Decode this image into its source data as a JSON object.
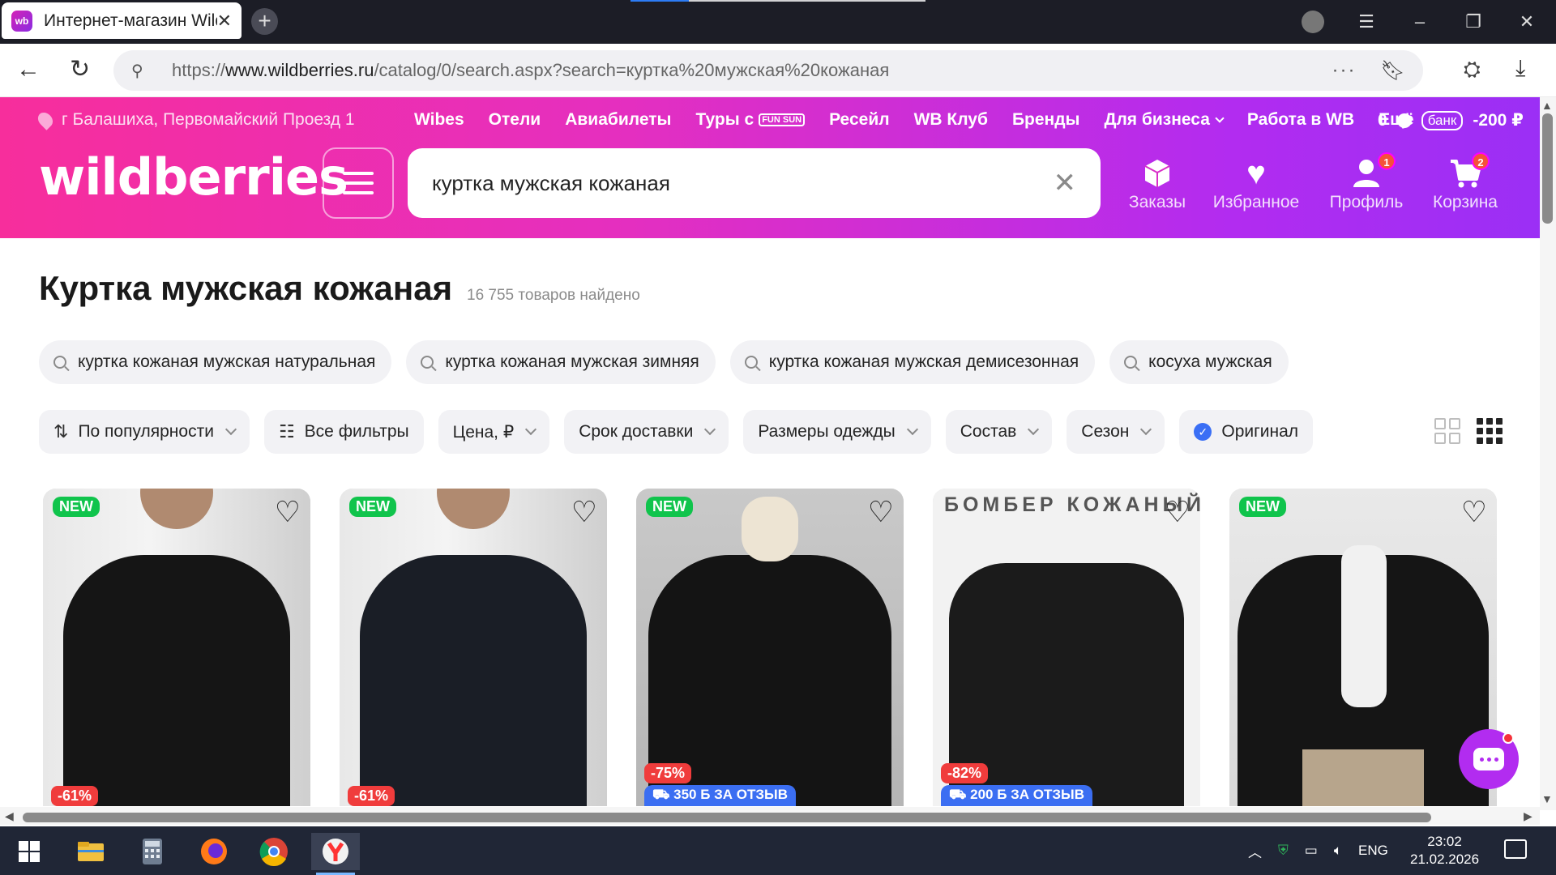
{
  "browser": {
    "tab_title": "Интернет-магазин Wildberries",
    "tab_favicon": "wb",
    "url_scheme": "https://",
    "url_host": "www.wildberries.ru",
    "url_path": "/catalog/0/search.aspx?search=куртка%20мужская%20кожаная"
  },
  "header": {
    "location": "г Балашиха, Первомайский Проезд 1",
    "links": [
      "Wibes",
      "Отели",
      "Авиабилеты",
      "Туры с",
      "Ресейл",
      "WB Клуб",
      "Бренды",
      "Для бизнеса",
      "Работа в WB",
      "Ещё"
    ],
    "funsun": "FUN SUN",
    "wallet_balance": "0",
    "bank_label": "банк",
    "bank_bonus": "-200 ₽",
    "logo": "wildberries",
    "search_query": "куртка мужская кожаная",
    "icons": [
      {
        "label": "Заказы",
        "badge": ""
      },
      {
        "label": "Избранное",
        "badge": ""
      },
      {
        "label": "Профиль",
        "badge": "1"
      },
      {
        "label": "Корзина",
        "badge": "2"
      }
    ],
    "colors": {
      "gradient_start": "#f72e9c",
      "gradient_end": "#9b2ff5"
    }
  },
  "page": {
    "title": "Куртка мужская кожаная",
    "count": "16 755 товаров найдено",
    "suggestions": [
      "куртка кожаная мужская натуральная",
      "куртка кожаная мужская зимняя",
      "куртка кожаная мужская демисезонная",
      "косуха мужская"
    ],
    "filters": [
      "По популярности",
      "Все фильтры",
      "Цена, ₽",
      "Срок доставки",
      "Размеры одежды",
      "Состав",
      "Сезон",
      "Оригинал"
    ]
  },
  "products": [
    {
      "new": "NEW",
      "discount": "-61%",
      "review_bonus": "",
      "banner": ""
    },
    {
      "new": "NEW",
      "discount": "-61%",
      "review_bonus": "",
      "banner": ""
    },
    {
      "new": "NEW",
      "discount": "-75%",
      "review_bonus": "350 Б ЗА ОТЗЫВ",
      "banner": ""
    },
    {
      "new": "",
      "discount": "-82%",
      "review_bonus": "200 Б ЗА ОТЗЫВ",
      "banner": "БОМБЕР КОЖАНЫЙ"
    },
    {
      "new": "NEW",
      "discount": "",
      "review_bonus": "",
      "banner": ""
    }
  ],
  "taskbar": {
    "lang": "ENG",
    "time": "23:02",
    "date": "21.02.2026"
  }
}
